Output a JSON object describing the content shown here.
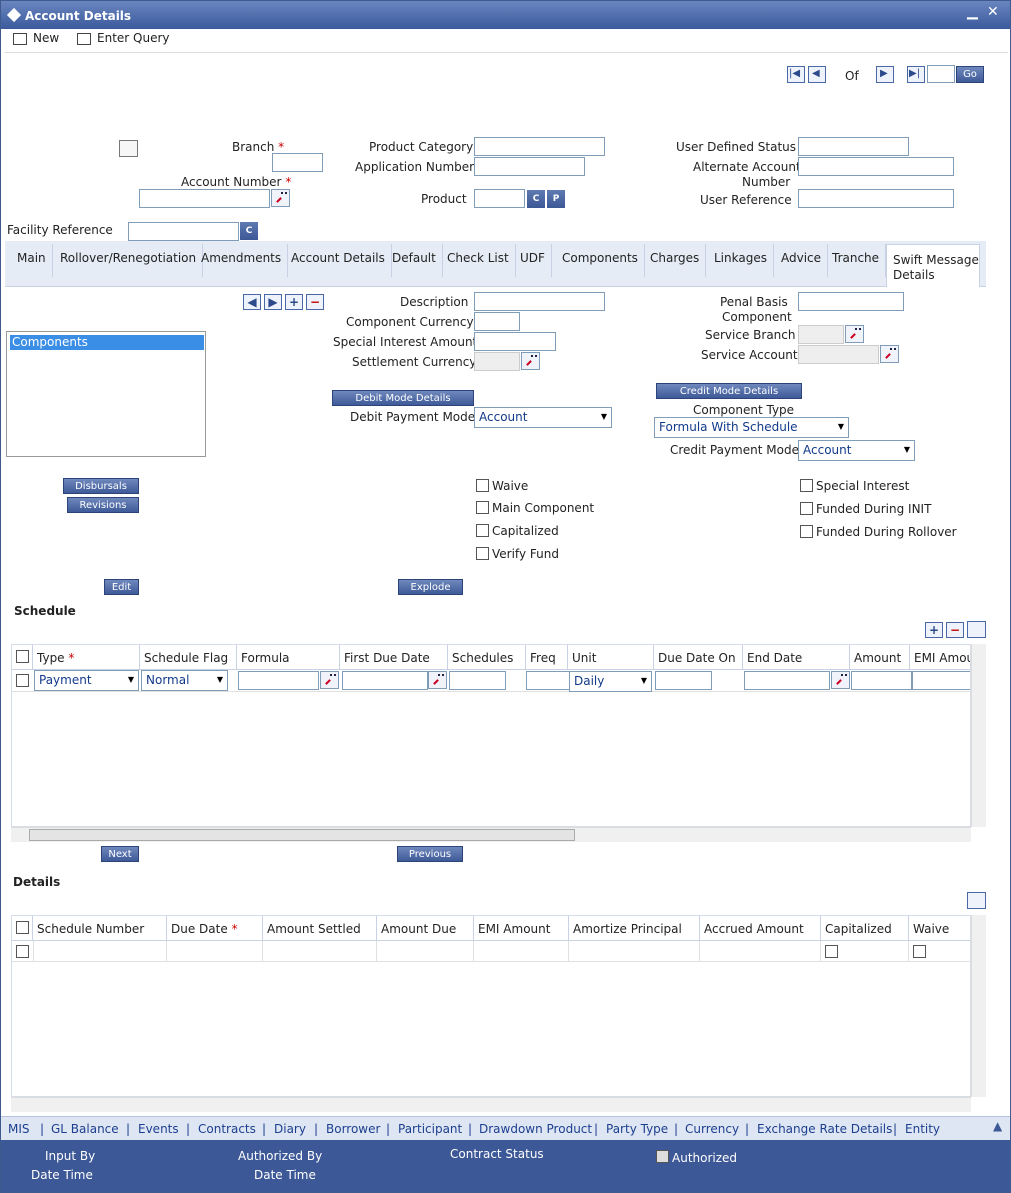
{
  "window": {
    "title": "Account Details"
  },
  "toolbar": {
    "new_label": "New",
    "enter_query_label": "Enter Query"
  },
  "pager": {
    "of_label": "Of",
    "go_label": "Go"
  },
  "header": {
    "branch_label": "Branch",
    "account_number_label": "Account Number",
    "facility_reference_label": "Facility Reference",
    "product_category_label": "Product Category",
    "application_number_label": "Application Number",
    "product_label": "Product",
    "user_defined_status_label": "User Defined Status",
    "alternate_account_number_label_1": "Alternate Account",
    "alternate_account_number_label_2": "Number",
    "user_reference_label": "User Reference",
    "c_label": "C",
    "p_label": "P"
  },
  "tabs": [
    "Main",
    "Rollover/Renegotiation",
    "Amendments",
    "Account Details",
    "Default",
    "Check List",
    "UDF",
    "Components",
    "Charges",
    "Linkages",
    "Advice",
    "Tranche",
    "Swift Message",
    "Details"
  ],
  "components": {
    "list_item": "Components",
    "description_label": "Description",
    "component_currency_label": "Component Currency",
    "special_interest_amount_label": "Special Interest Amount",
    "settlement_currency_label": "Settlement Currency",
    "penal_basis_label_1": "Penal Basis",
    "penal_basis_label_2": "Component",
    "service_branch_label": "Service Branch",
    "service_account_label": "Service Account",
    "debit_mode_details": "Debit Mode Details",
    "debit_payment_mode_label": "Debit Payment Mode",
    "debit_payment_mode_value": "Account",
    "credit_mode_details": "Credit Mode Details",
    "component_type_label": "Component Type",
    "component_type_value": "Formula With Schedule",
    "credit_payment_mode_label": "Credit Payment Mode",
    "credit_payment_mode_value": "Account",
    "disbursals": "Disbursals",
    "revisions": "Revisions",
    "waive": "Waive",
    "main_component": "Main Component",
    "capitalized": "Capitalized",
    "verify_fund": "Verify Fund",
    "special_interest": "Special Interest",
    "funded_during_init": "Funded During INIT",
    "funded_during_rollover": "Funded During Rollover",
    "edit": "Edit",
    "explode": "Explode"
  },
  "schedule": {
    "title": "Schedule",
    "columns": [
      "Type",
      "Schedule Flag",
      "Formula",
      "First Due Date",
      "Schedules",
      "Freq",
      "Unit",
      "Due Date On",
      "End Date",
      "Amount",
      "EMI Amou"
    ],
    "row": {
      "type": "Payment",
      "flag": "Normal",
      "unit": "Daily"
    },
    "next": "Next",
    "previous": "Previous"
  },
  "details": {
    "title": "Details",
    "columns": [
      "Schedule Number",
      "Due Date",
      "Amount Settled",
      "Amount Due",
      "EMI Amount",
      "Amortize Principal",
      "Accrued Amount",
      "Capitalized",
      "Waive"
    ]
  },
  "links": [
    "MIS",
    "GL Balance",
    "Events",
    "Contracts",
    "Diary",
    "Borrower",
    "Participant",
    "Drawdown Product",
    "Party Type",
    "Currency",
    "Exchange Rate Details",
    "Entity"
  ],
  "footer": {
    "input_by": "Input By",
    "date_time": "Date Time",
    "authorized_by": "Authorized By",
    "contract_status": "Contract Status",
    "authorized": "Authorized"
  }
}
